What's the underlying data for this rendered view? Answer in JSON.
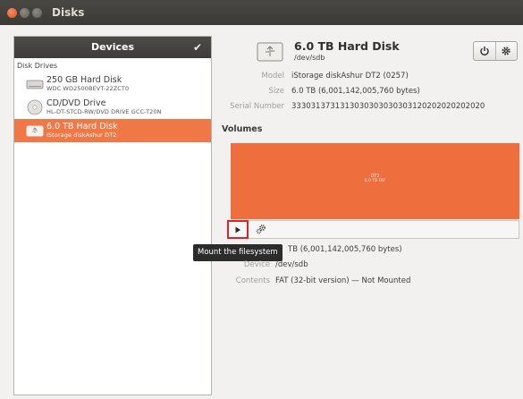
{
  "window": {
    "title": "Disks"
  },
  "sidebar": {
    "header": "Devices",
    "section_label": "Disk Drives",
    "items": [
      {
        "name": "250 GB Hard Disk",
        "sub": "WDC WD2500BEVT-22ZCT0",
        "icon": "hard-disk-icon",
        "selected": false
      },
      {
        "name": "CD/DVD Drive",
        "sub": "HL-DT-STCD-RW/DVD DRIVE GCC-T20N",
        "icon": "optical-drive-icon",
        "selected": false
      },
      {
        "name": "6.0 TB Hard Disk",
        "sub": "iStorage diskAshur DT2",
        "icon": "usb-disk-icon",
        "selected": true
      }
    ]
  },
  "disk": {
    "title": "6.0 TB Hard Disk",
    "device": "/dev/sdb",
    "model_label": "Model",
    "model": "iStorage diskAshur DT2 (0257)",
    "size_label": "Size",
    "size": "6.0 TB (6,001,142,005,760 bytes)",
    "serial_label": "Serial Number",
    "serial": "3330313731313030303030303120202020202020"
  },
  "volumes": {
    "heading": "Volumes",
    "block_name": "DT2",
    "block_size": "6.0 TB FAT",
    "size_partial": "TB (6,001,142,005,760 bytes)",
    "device_label": "Device",
    "device": "/dev/sdb",
    "contents_label": "Contents",
    "contents": "FAT (32-bit version) — Not Mounted"
  },
  "tooltip": "Mount the filesystem",
  "colors": {
    "accent": "#ef6e3e",
    "highlight": "#d8242b",
    "titlebar": "#3c3b37"
  }
}
